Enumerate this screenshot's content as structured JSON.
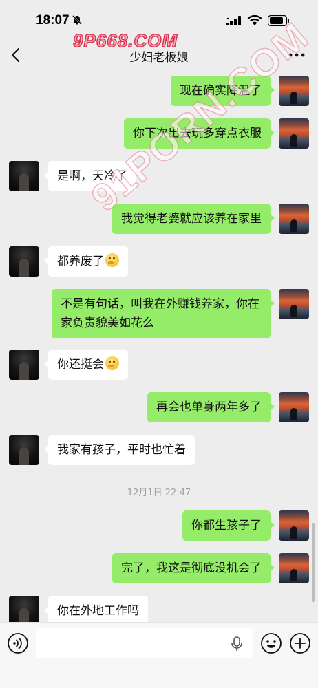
{
  "status_bar": {
    "time": "18:07",
    "icons": [
      "bell-off-icon",
      "signal-icon",
      "wifi-icon",
      "battery-icon"
    ]
  },
  "watermark": {
    "logo": "9P668.COM",
    "diagonal": "91PORN.COM"
  },
  "nav": {
    "title": "少妇老板娘",
    "back_icon": "chevron-left-icon",
    "more_icon": "more-dots-icon"
  },
  "messages": [
    {
      "sender": "me",
      "text": "现在确实降温了"
    },
    {
      "sender": "me",
      "text": "你下次出去玩多穿点衣服"
    },
    {
      "sender": "them",
      "text": "是啊，天冷了"
    },
    {
      "sender": "me",
      "text": "我觉得老婆就应该养在家里"
    },
    {
      "sender": "them",
      "text": "都养废了",
      "emoji": "thinking-face"
    },
    {
      "sender": "me",
      "text": "不是有句话，叫我在外赚钱养家，你在家负责貌美如花么"
    },
    {
      "sender": "them",
      "text": "你还挺会",
      "emoji": "thinking-face"
    },
    {
      "sender": "me",
      "text": "再会也单身两年多了"
    },
    {
      "sender": "them",
      "text": "我家有孩子，平时也忙着"
    },
    {
      "sender": "me",
      "text": "你都生孩子了"
    },
    {
      "sender": "me",
      "text": "完了，我这是彻底没机会了"
    },
    {
      "sender": "them",
      "text": "你在外地工作吗"
    }
  ],
  "timestamp": "12月1日 22:47",
  "input_bar": {
    "icons": [
      "voice-icon",
      "mic-icon",
      "emoji-icon",
      "plus-icon"
    ]
  },
  "colors": {
    "my_bubble": "#95ec69",
    "their_bubble": "#ffffff",
    "background": "#ededed"
  }
}
